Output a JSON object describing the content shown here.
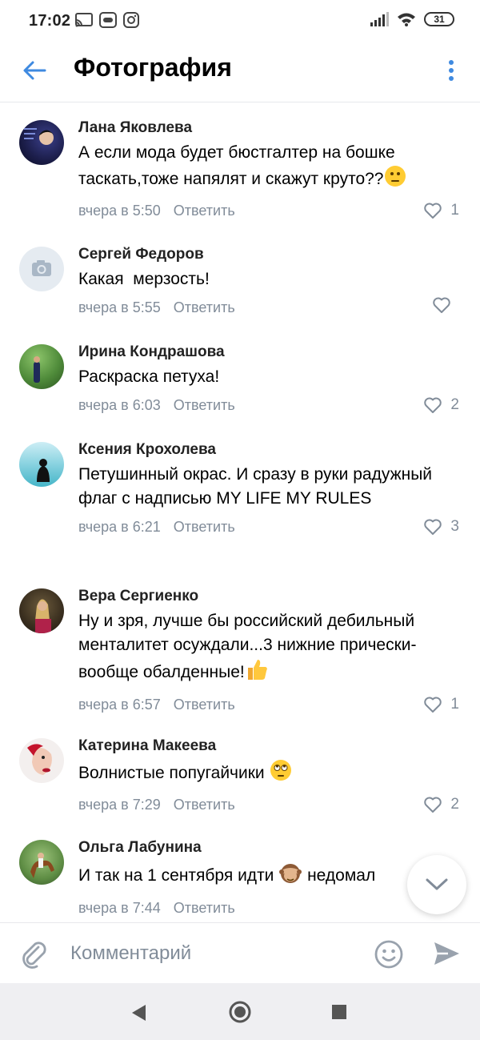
{
  "status": {
    "time": "17:02",
    "battery": "31"
  },
  "header": {
    "title": "Фотография"
  },
  "comments": [
    {
      "author": "Лана Яковлева",
      "text": "А если мода будет бюстгалтер на бошке таскать,тоже напялят и скажут круто??",
      "time": "вчера в 5:50",
      "reply": "Ответить",
      "likes": "1",
      "emoji": "neutral-face"
    },
    {
      "author": "Сергей Федоров",
      "text": "Какая  мерзость!",
      "time": "вчера в 5:55",
      "reply": "Ответить",
      "likes": ""
    },
    {
      "author": "Ирина Кондрашова",
      "text": "Раскраска петуха!",
      "time": "вчера в 6:03",
      "reply": "Ответить",
      "likes": "2"
    },
    {
      "author": "Ксения Крохолева",
      "text": "Петушинный окрас. И сразу в руки радужный флаг с надписью MY LIFE MY RULES",
      "time": "вчера в 6:21",
      "reply": "Ответить",
      "likes": "3"
    },
    {
      "author": "Вера Сергиенко",
      "text": "Ну и зря, лучше бы российский дебильный менталитет осуждали...3 нижние прически-вообще обалденные!",
      "time": "вчера в 6:57",
      "reply": "Ответить",
      "likes": "1",
      "emoji": "thumbs-up"
    },
    {
      "author": "Катерина Макеева",
      "text": "Волнистые попугайчики ",
      "time": "вчера в 7:29",
      "reply": "Ответить",
      "likes": "2",
      "emoji": "eye-roll-face"
    },
    {
      "author": "Ольга Лабунина",
      "text": "И так на 1 сентября идти ",
      "text_after": " недомал",
      "time": "вчера в 7:44",
      "reply": "Ответить",
      "likes": "",
      "emoji": "see-no-evil-monkey"
    }
  ],
  "composer": {
    "placeholder": "Комментарий"
  },
  "colors": {
    "accent": "#3f8ae0",
    "secondary": "#818c99",
    "divider": "#e7e8ec"
  }
}
